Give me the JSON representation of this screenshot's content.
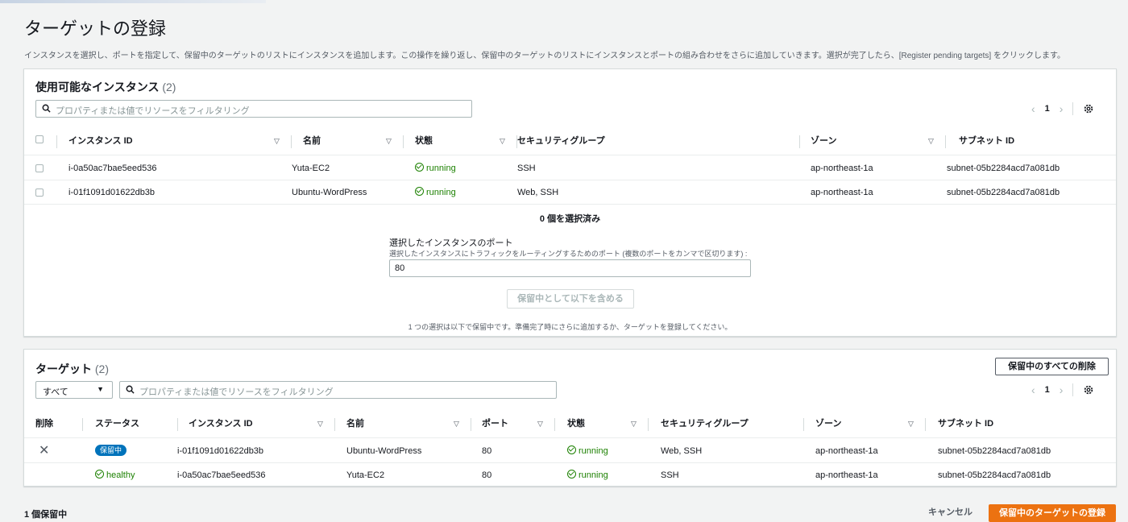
{
  "page": {
    "title": "ターゲットの登録",
    "description": "インスタンスを選択し、ポートを指定して、保留中のターゲットのリストにインスタンスを追加します。この操作を繰り返し、保留中のターゲットのリストにインスタンスとポートの組み合わせをさらに追加していきます。選択が完了したら、[Register pending targets] をクリックします。"
  },
  "available": {
    "title": "使用可能なインスタンス",
    "count": "(2)",
    "search_placeholder": "プロパティまたは値でリソースをフィルタリング",
    "page": "1",
    "columns": {
      "id": "インスタンス ID",
      "name": "名前",
      "state": "状態",
      "sg": "セキュリティグループ",
      "zone": "ゾーン",
      "subnet": "サブネット ID"
    },
    "rows": [
      {
        "id": "i-0a50ac7bae5eed536",
        "name": "Yuta-EC2",
        "state": "running",
        "sg": "SSH",
        "zone": "ap-northeast-1a",
        "subnet": "subnet-05b2284acd7a081db"
      },
      {
        "id": "i-01f1091d01622db3b",
        "name": "Ubuntu-WordPress",
        "state": "running",
        "sg": "Web, SSH",
        "zone": "ap-northeast-1a",
        "subnet": "subnet-05b2284acd7a081db"
      }
    ],
    "selected_text": "0 個を選択済み",
    "port_label": "選択したインスタンスのポート",
    "port_desc": "選択したインスタンスにトラフィックをルーティングするためのポート (複数のポートをカンマで区切ります) :",
    "port_value": "80",
    "include_button": "保留中として以下を含める",
    "pending_note": "1 つの選択は以下で保留中です。準備完了時にさらに追加するか、ターゲットを登録してください。"
  },
  "targets": {
    "title": "ターゲット",
    "count": "(2)",
    "remove_all_button": "保留中のすべての削除",
    "filter_select": "すべて",
    "search_placeholder": "プロパティまたは値でリソースをフィルタリング",
    "page": "1",
    "columns": {
      "remove": "削除",
      "status": "ステータス",
      "id": "インスタンス ID",
      "name": "名前",
      "port": "ポート",
      "state": "状態",
      "sg": "セキュリティグループ",
      "zone": "ゾーン",
      "subnet": "サブネット ID"
    },
    "rows": [
      {
        "status": "保留中",
        "id": "i-01f1091d01622db3b",
        "name": "Ubuntu-WordPress",
        "port": "80",
        "state": "running",
        "sg": "Web, SSH",
        "zone": "ap-northeast-1a",
        "subnet": "subnet-05b2284acd7a081db"
      },
      {
        "status": "healthy",
        "id": "i-0a50ac7bae5eed536",
        "name": "Yuta-EC2",
        "port": "80",
        "state": "running",
        "sg": "SSH",
        "zone": "ap-northeast-1a",
        "subnet": "subnet-05b2284acd7a081db"
      }
    ]
  },
  "footer": {
    "pending_count": "1 個保留中",
    "cancel": "キャンセル",
    "register": "保留中のターゲットの登録"
  }
}
